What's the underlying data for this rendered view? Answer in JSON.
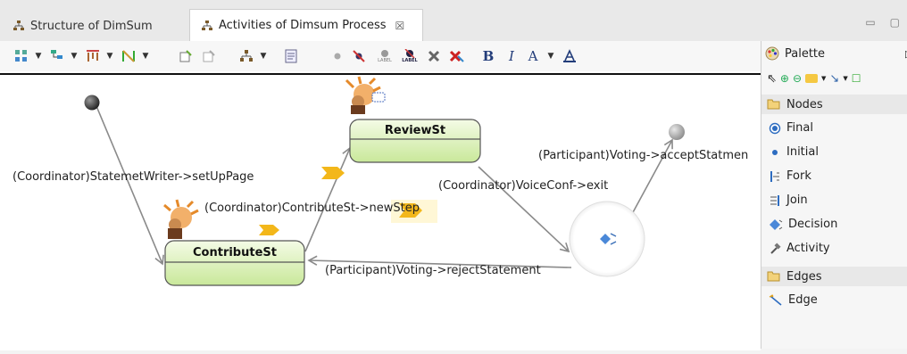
{
  "tabs": [
    {
      "label": "Structure of DimSum",
      "active": false
    },
    {
      "label": "Activities of Dimsum Process",
      "active": true,
      "close": "☒"
    }
  ],
  "window_buttons": {
    "minimize": "▭",
    "maximize": "▢"
  },
  "toolbar": {
    "font_bold": "B",
    "font_italic": "I",
    "font_color": "A",
    "label_text_1": "LABEL",
    "label_text_2": "LABEL"
  },
  "diagram": {
    "states": [
      {
        "name": "ReviewSt"
      },
      {
        "name": "ContributeSt"
      }
    ],
    "edges": [
      {
        "label": "(Coordinator)StatemetWriter->setUpPage"
      },
      {
        "label": "(Coordinator)ContributeSt->newStep"
      },
      {
        "label": "(Participant)Voting->acceptStatmen"
      },
      {
        "label": "(Coordinator)VoiceConf->exit"
      },
      {
        "label": "(Participant)Voting->rejectStatement"
      }
    ]
  },
  "palette": {
    "title": "Palette",
    "nodes_drawer": "Nodes",
    "nodes": [
      "Final",
      "Initial",
      "Fork",
      "Join",
      "Decision",
      "Activity"
    ],
    "edges_drawer": "Edges",
    "edges": [
      "Edge"
    ]
  },
  "colors": {
    "state_fill_top": "#f4fbe6",
    "state_fill_bottom": "#c9e89a",
    "decision_fill": "#f2f2f2",
    "initial_node": "#3a3a3a",
    "final_node": "#a0a0a0",
    "arrow": "#8a8a8a"
  }
}
